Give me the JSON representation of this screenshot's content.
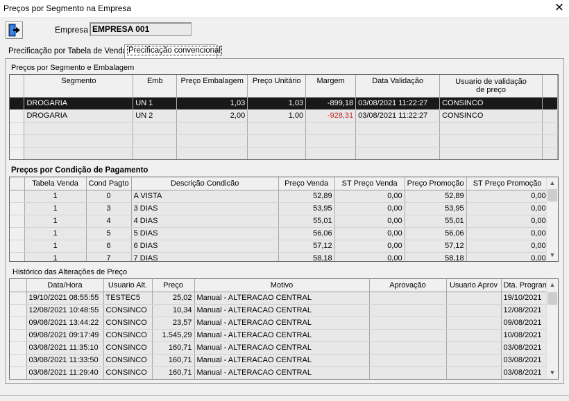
{
  "window": {
    "title": "Preços por Segmento na Empresa",
    "close_glyph": "✕"
  },
  "header": {
    "empresa_label": "Empresa",
    "empresa_value": "EMPRESA 001"
  },
  "tabs": [
    {
      "label": "Precificação por Tabela de Venda"
    },
    {
      "label": "Precificação convencional"
    }
  ],
  "segmento": {
    "label": "Preços por Segmento e Embalagem",
    "columns": [
      "Segmento",
      "Emb",
      "Preço Embalagem",
      "Preço Unitário",
      "Margem",
      "Data Validação",
      "Usuario de validação de preço"
    ],
    "rows": [
      {
        "segmento": "DROGARIA",
        "emb": "UN 1",
        "preco_emb": "1,03",
        "preco_unit": "1,03",
        "margem": "-899,18",
        "data": "03/08/2021  11:22:27",
        "usuario": "CONSINCO"
      },
      {
        "segmento": "DROGARIA",
        "emb": "UN 2",
        "preco_emb": "2,00",
        "preco_unit": "1,00",
        "margem": "-928,31",
        "data": "03/08/2021  11:22:27",
        "usuario": "CONSINCO"
      }
    ]
  },
  "pagamento": {
    "label": "Preços por Condição de Pagamento",
    "columns": [
      "Tabela Venda",
      "Cond Pagto",
      "Descrição Condicão",
      "Preço Venda",
      "ST Preço Venda",
      "Preço Promoção",
      "ST Preço Promoção"
    ],
    "rows": [
      {
        "tabela": "1",
        "cond": "0",
        "desc": "A VISTA",
        "preco": "52,89",
        "st": "0,00",
        "promo": "52,89",
        "st_promo": "0,00"
      },
      {
        "tabela": "1",
        "cond": "3",
        "desc": "3 DIAS",
        "preco": "53,95",
        "st": "0,00",
        "promo": "53,95",
        "st_promo": "0,00"
      },
      {
        "tabela": "1",
        "cond": "4",
        "desc": "4 DIAS",
        "preco": "55,01",
        "st": "0,00",
        "promo": "55,01",
        "st_promo": "0,00"
      },
      {
        "tabela": "1",
        "cond": "5",
        "desc": "5 DIAS",
        "preco": "56,06",
        "st": "0,00",
        "promo": "56,06",
        "st_promo": "0,00"
      },
      {
        "tabela": "1",
        "cond": "6",
        "desc": "6 DIAS",
        "preco": "57,12",
        "st": "0,00",
        "promo": "57,12",
        "st_promo": "0,00"
      },
      {
        "tabela": "1",
        "cond": "7",
        "desc": "7 DIAS",
        "preco": "58,18",
        "st": "0,00",
        "promo": "58,18",
        "st_promo": "0,00"
      }
    ]
  },
  "historico": {
    "label": "Histórico das Alterações de Preço",
    "columns": [
      "Data/Hora",
      "Usuario Alt.",
      "Preço",
      "Motivo",
      "Aprovação",
      "Usuario Aprov",
      "Dta. Program"
    ],
    "rows": [
      {
        "data": "19/10/2021  08:55:55",
        "usuario": "TESTEC5",
        "preco": "25,02",
        "motivo": "Manual - ALTERACAO CENTRAL",
        "aprov": "",
        "usr_aprov": "",
        "dta": "19/10/2021"
      },
      {
        "data": "12/08/2021  10:48:55",
        "usuario": "CONSINCO",
        "preco": "10,34",
        "motivo": "Manual - ALTERACAO CENTRAL",
        "aprov": "",
        "usr_aprov": "",
        "dta": "12/08/2021"
      },
      {
        "data": "09/08/2021  13:44:22",
        "usuario": "CONSINCO",
        "preco": "23,57",
        "motivo": "Manual - ALTERACAO CENTRAL",
        "aprov": "",
        "usr_aprov": "",
        "dta": "09/08/2021"
      },
      {
        "data": "09/08/2021  09:17:49",
        "usuario": "CONSINCO",
        "preco": "1.545,29",
        "motivo": "Manual - ALTERACAO CENTRAL",
        "aprov": "",
        "usr_aprov": "",
        "dta": "10/08/2021"
      },
      {
        "data": "03/08/2021  11:35:10",
        "usuario": "CONSINCO",
        "preco": "160,71",
        "motivo": "Manual - ALTERACAO CENTRAL",
        "aprov": "",
        "usr_aprov": "",
        "dta": "03/08/2021"
      },
      {
        "data": "03/08/2021  11:33:50",
        "usuario": "CONSINCO",
        "preco": "160,71",
        "motivo": "Manual - ALTERACAO CENTRAL",
        "aprov": "",
        "usr_aprov": "",
        "dta": "03/08/2021"
      },
      {
        "data": "03/08/2021  11:29:40",
        "usuario": "CONSINCO",
        "preco": "160,71",
        "motivo": "Manual - ALTERACAO CENTRAL",
        "aprov": "",
        "usr_aprov": "",
        "dta": "03/08/2021"
      }
    ]
  },
  "colors": {
    "selected_row": "#191919",
    "margin_positive": "#1ec8c8",
    "margin_negative": "#e11b1b"
  },
  "icons": {
    "exit": "exit-door-icon",
    "scroll_up": "chevron-up-icon",
    "scroll_down": "chevron-down-icon"
  }
}
